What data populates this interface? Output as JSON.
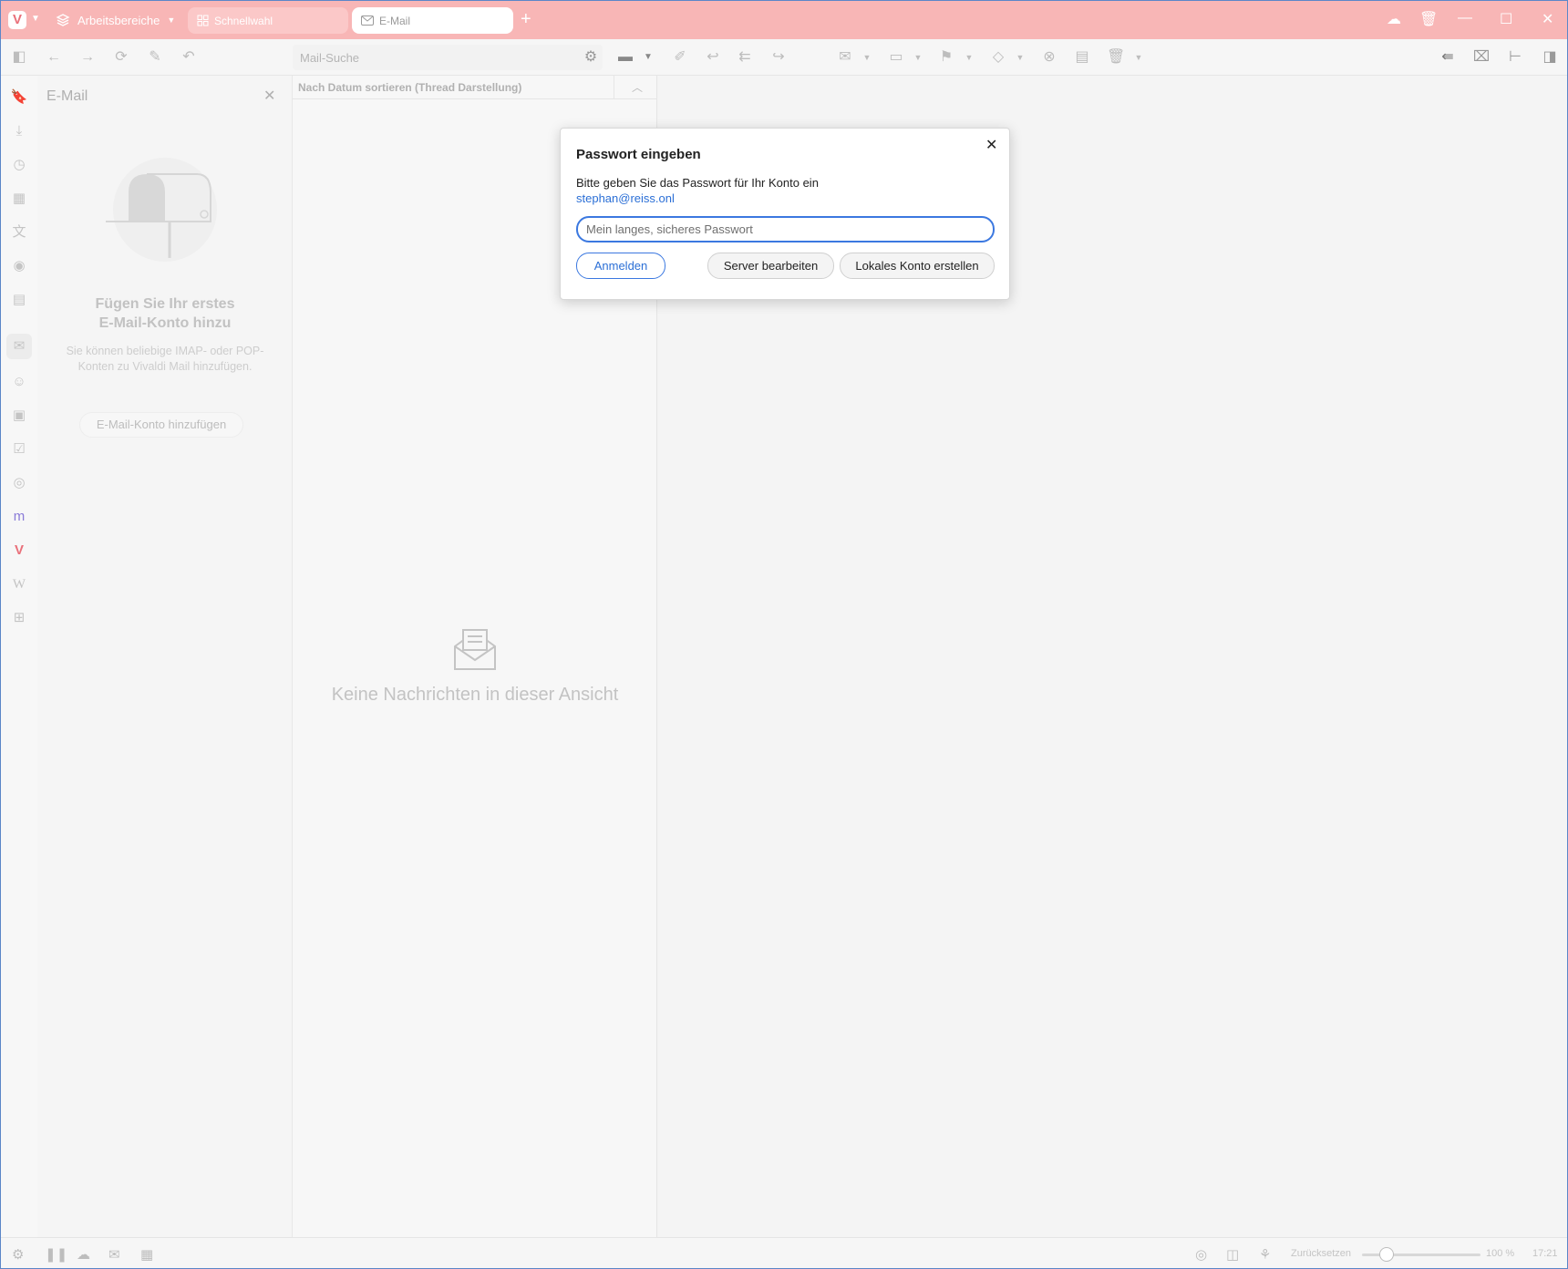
{
  "app": {
    "logo_letter": "V",
    "workspaces_label": "Arbeitsbereiche",
    "tabs": [
      {
        "label": "Schnellwahl",
        "icon": "grid-icon"
      },
      {
        "label": "E-Mail",
        "icon": "mail-icon"
      }
    ],
    "accent_color": "#f8b6b6"
  },
  "toolbar": {
    "search_placeholder": "Mail-Suche"
  },
  "mail_panel": {
    "title": "E-Mail",
    "heading_line1": "Fügen Sie Ihr erstes",
    "heading_line2": "E-Mail-Konto hinzu",
    "subtext": "Sie können beliebige IMAP- oder POP-Konten zu Vivaldi Mail hinzufügen.",
    "add_button": "E-Mail-Konto hinzufügen"
  },
  "message_list": {
    "sort_label": "Nach Datum sortieren (Thread Darstellung)",
    "empty_text": "Keine Nachrichten in dieser Ansicht"
  },
  "dialog": {
    "title": "Passwort eingeben",
    "message": "Bitte geben Sie das Passwort für Ihr Konto ein",
    "email": "stephan@reiss.onl",
    "input_value": "",
    "input_placeholder": "Mein langes, sicheres Passwort",
    "login_button": "Anmelden",
    "server_button": "Server bearbeiten",
    "local_button": "Lokales Konto erstellen",
    "link_color": "#2b6fd6"
  },
  "statusbar": {
    "reset_label": "Zurücksetzen",
    "zoom": "100 %",
    "time": "17:21"
  }
}
